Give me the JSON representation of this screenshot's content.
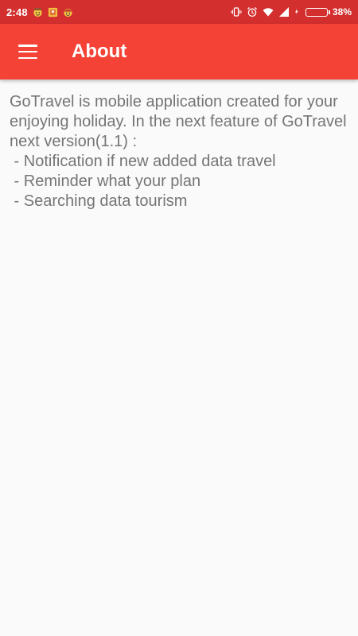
{
  "status_bar": {
    "time": "2:48",
    "battery_percent": "38%",
    "battery_level": 0.38,
    "notification_icons": [
      "emoji-face-icon",
      "gallery-icon",
      "emoji-face-icon"
    ],
    "system_icons": [
      "vibrate-icon",
      "alarm-icon",
      "wifi-icon",
      "signal-icon",
      "charging-icon"
    ]
  },
  "app_bar": {
    "title": "About",
    "menu_icon": "hamburger-menu-icon"
  },
  "about": {
    "intro": "GoTravel is mobile application created for your enjoying holiday.  In the next feature of GoTravel next version(1.1) :",
    "features": [
      " - Notification if new added data travel",
      " - Reminder what your plan",
      " - Searching data tourism"
    ]
  },
  "colors": {
    "status_bar": "#d32f2f",
    "app_bar": "#f44336",
    "background": "#fafafa",
    "text": "#757575"
  }
}
